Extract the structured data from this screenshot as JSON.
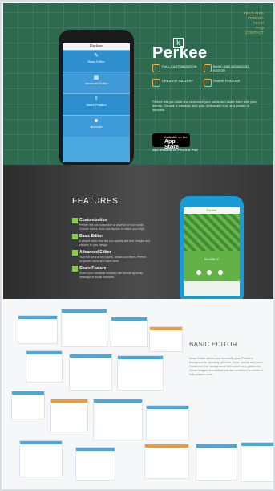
{
  "nav": [
    "FEATURES",
    "PRICING",
    "TEAM",
    "FAQ",
    "CONTACT"
  ],
  "phone": {
    "status_title": "Perkee",
    "menu": [
      {
        "icon": "edit-icon",
        "label": "Basic Editor"
      },
      {
        "icon": "layers-icon",
        "label": "Advanced Editor"
      },
      {
        "icon": "share-icon",
        "label": "Share Feature"
      },
      {
        "icon": "user-icon",
        "label": "Account"
      }
    ]
  },
  "brand": {
    "name": "Perkee",
    "badge": "k"
  },
  "hero_features": [
    {
      "icon": "customize-icon",
      "text": "FULL CUSTOMIZATION"
    },
    {
      "icon": "layers-icon",
      "text": "BASIC AND ADVANCED EDITOR"
    },
    {
      "icon": "gallery-icon",
      "text": "CREATIVE GALLERY"
    },
    {
      "icon": "share-icon",
      "text": "SHARE FEATURE"
    }
  ],
  "hero_description": "Perkee lets you build and customize your cards and share them with your friends. Choose a template, add your photos and text, and publish in seconds.",
  "app_store": {
    "line1": "Available on the",
    "line2": "App Store"
  },
  "available_text": "Also available on iPhone & iPad",
  "features": {
    "title": "FEATURES",
    "items": [
      {
        "title": "Customization",
        "desc": "Perkee lets you customize all aspects of your cards. Choose colors, fonts and layouts to match your style."
      },
      {
        "title": "Basic Editor",
        "desc": "A simple editor that lets you quickly add text, images and stickers to your design."
      },
      {
        "title": "Advanced Editor",
        "desc": "Take full control with layers, masks and filters. Perfect for power users who want more."
      },
      {
        "title": "Share Feature",
        "desc": "Share your creations instantly with friends by email, message or social networks."
      }
    ],
    "phone_title": "Perkee",
    "phone_share": "SHARE IT"
  },
  "editor": {
    "title": "BASIC EDITOR",
    "desc": "Basic Editor allows you to modify your Perkee's backgrounds, drawing, stickers, fonts, words and more. Customize the background with colors and gradients. Some images and assets can be combined to create a truly unique card."
  }
}
